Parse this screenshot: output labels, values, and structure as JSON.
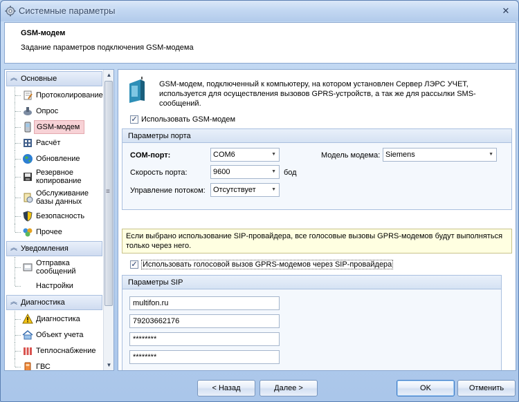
{
  "window": {
    "title": "Системные параметры",
    "close_icon": "close-icon"
  },
  "header": {
    "title": "GSM-модем",
    "subtitle": "Задание параметров подключения GSM-модема"
  },
  "navigator": {
    "groups": [
      {
        "label": "Основные",
        "items": [
          {
            "label": "Протоколирование",
            "icon": "log-icon"
          },
          {
            "label": "Опрос",
            "icon": "poll-icon"
          },
          {
            "label": "GSM-модем",
            "icon": "phone-icon",
            "selected": true
          },
          {
            "label": "Расчёт",
            "icon": "calculator-icon"
          },
          {
            "label": "Обновление",
            "icon": "globe-icon"
          },
          {
            "label": "Резервное копирование",
            "icon": "backup-icon"
          },
          {
            "label": "Обслуживание базы данных",
            "icon": "database-icon"
          },
          {
            "label": "Безопасность",
            "icon": "shield-icon"
          },
          {
            "label": "Прочее",
            "icon": "misc-icon"
          }
        ]
      },
      {
        "label": "Уведомления",
        "items": [
          {
            "label": "Отправка сообщений",
            "icon": "send-icon"
          },
          {
            "label": "Настройки",
            "icon": ""
          }
        ]
      },
      {
        "label": "Диагностика",
        "items": [
          {
            "label": "Диагностика",
            "icon": "warning-icon"
          },
          {
            "label": "Объект учета",
            "icon": "house-icon"
          },
          {
            "label": "Теплоснабжение",
            "icon": "radiator-icon"
          },
          {
            "label": "ГВС",
            "icon": "water-icon"
          }
        ]
      }
    ]
  },
  "content": {
    "info": "GSM-модем, подключенный к компьютеру, на котором установлен Сервер ЛЭРС УЧЕТ, используется для осуществления вызовов GPRS-устройств, а так же для рассылки SMS-сообщений.",
    "use_modem_label": "Использовать GSM-модем",
    "use_modem_checked": true,
    "port_group": {
      "title": "Параметры порта",
      "com_label": "COM-порт:",
      "com_value": "COM6",
      "speed_label": "Скорость порта:",
      "speed_value": "9600",
      "speed_unit": "бод",
      "flow_label": "Управление потоком:",
      "flow_value": "Отсутствует",
      "model_label": "Модель модема:",
      "model_value": "Siemens"
    },
    "sip_note": "Если выбрано использование SIP-провайдера, все голосовые вызовы GPRS-модемов будут выполняться только через него.",
    "use_sip_label": "Использовать голосовой вызов GPRS-модемов через SIP-провайдера",
    "use_sip_checked": true,
    "sip_group": {
      "title": "Параметры SIP",
      "server": "multifon.ru",
      "login": "79203662176",
      "password1": "********",
      "password2": "********"
    }
  },
  "footer": {
    "back": "< Назад",
    "next": "Далее >",
    "ok": "OK",
    "cancel": "Отменить"
  }
}
